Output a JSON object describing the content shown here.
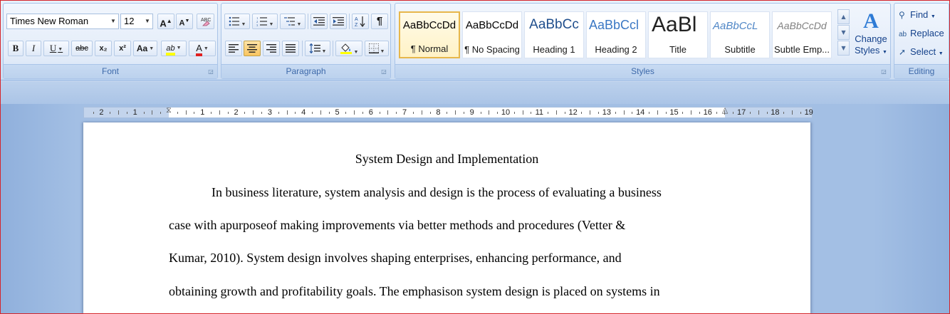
{
  "font": {
    "family": "Times New Roman",
    "size": "12",
    "grow_label": "A",
    "shrink_label": "A",
    "bold": "B",
    "italic": "I",
    "underline": "U",
    "strike": "abc",
    "subscript": "x₂",
    "superscript": "x²",
    "change_case": "Aa",
    "highlight": "ab",
    "font_color": "A",
    "group_label": "Font"
  },
  "paragraph": {
    "group_label": "Paragraph",
    "pilcrow": "¶"
  },
  "styles": {
    "group_label": "Styles",
    "items": [
      {
        "sample": "AaBbCcDd",
        "name": "¶ Normal"
      },
      {
        "sample": "AaBbCcDd",
        "name": "¶ No Spacing"
      },
      {
        "sample": "AaBbCc",
        "name": "Heading 1"
      },
      {
        "sample": "AaBbCcl",
        "name": "Heading 2"
      },
      {
        "sample": "AaBl",
        "name": "Title"
      },
      {
        "sample": "AaBbCcL",
        "name": "Subtitle"
      },
      {
        "sample": "AaBbCcDd",
        "name": "Subtle Emp..."
      }
    ],
    "change_styles_icon": "A",
    "change_styles_line1": "Change",
    "change_styles_line2": "Styles"
  },
  "editing": {
    "group_label": "Editing",
    "find": "Find",
    "replace": "Replace",
    "select": "Select"
  },
  "ruler": {
    "left_numbers": [
      "2",
      "1"
    ],
    "right_numbers": [
      "1",
      "2",
      "3",
      "4",
      "5",
      "6",
      "7",
      "8",
      "9",
      "10",
      "11",
      "12",
      "13",
      "14",
      "15",
      "16",
      "17",
      "18",
      "19"
    ]
  },
  "document": {
    "title": "System Design and Implementation",
    "lines": [
      "In business literature, system analysis and design is the process of evaluating a business",
      "case with apurposeof making improvements via better methods and procedures (Vetter &",
      "Kumar, 2010). System design involves shaping enterprises, enhancing performance, and",
      "obtaining growth and profitability goals. The emphasison system design is placed on systems in"
    ]
  },
  "colors": {
    "highlight": "#ffff00",
    "font_color": "#e02020",
    "selected_style": "#e7b74b",
    "frame": "#d6262b"
  }
}
